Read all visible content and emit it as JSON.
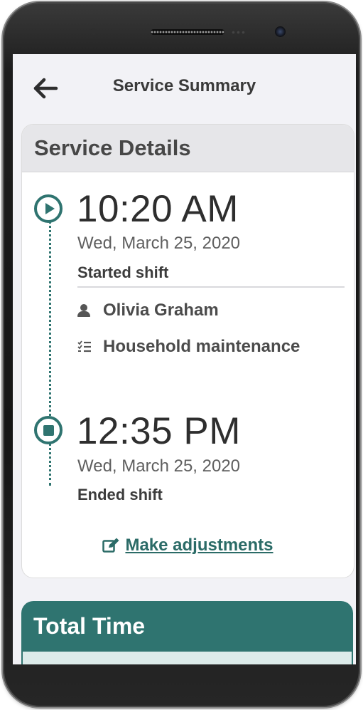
{
  "header": {
    "title": "Service Summary",
    "back_icon": "arrow-left-icon"
  },
  "service_details": {
    "title": "Service Details",
    "start": {
      "time": "10:20 AM",
      "date": "Wed, March 25, 2020",
      "label": "Started shift",
      "icon": "play-circle-icon"
    },
    "caregiver": {
      "name": "Olivia Graham",
      "icon": "person-icon"
    },
    "service_type": {
      "name": "Household maintenance",
      "icon": "task-list-icon"
    },
    "end": {
      "time": "12:35 PM",
      "date": "Wed, March 25, 2020",
      "label": "Ended shift",
      "icon": "stop-circle-icon"
    },
    "adjust_link": "Make adjustments",
    "adjust_icon": "edit-icon"
  },
  "total_time": {
    "title": "Total Time"
  },
  "colors": {
    "accent": "#2f7470",
    "accent_light": "#dcebea",
    "screen_background": "#f2f2f6",
    "card_header": "#e6e6e9"
  }
}
